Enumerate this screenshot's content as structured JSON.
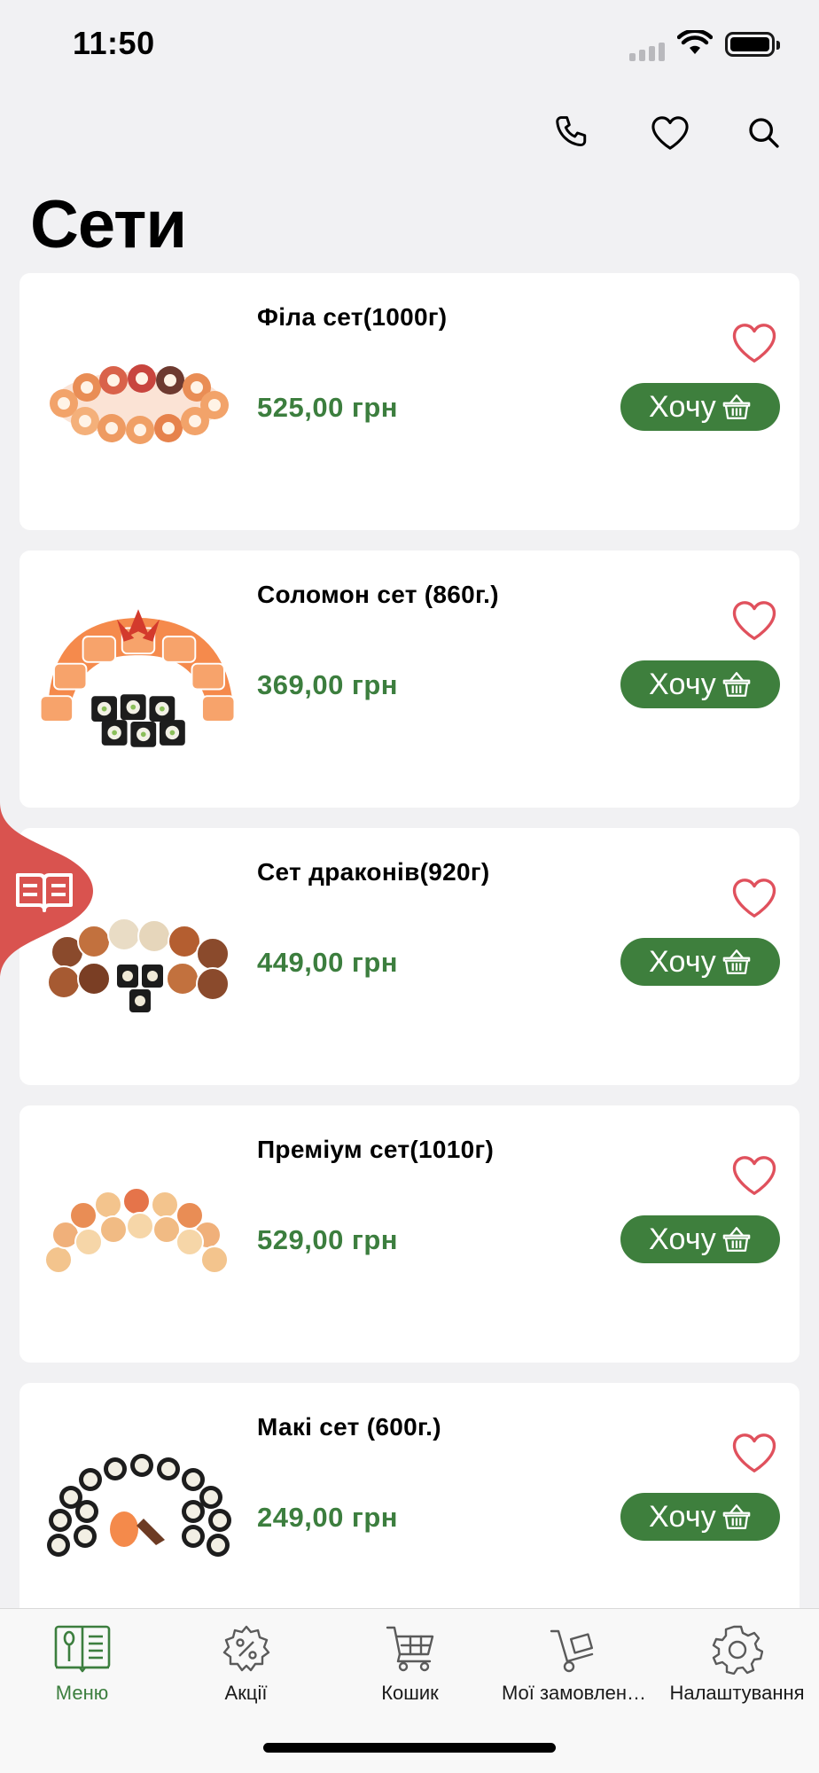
{
  "status_bar": {
    "time": "11:50"
  },
  "colors": {
    "accent": "#3e7f3d",
    "heart": "#e0515d",
    "side_tab": "#d9534f"
  },
  "header": {
    "title": "Сети",
    "icons": [
      "phone-icon",
      "heart-icon",
      "search-icon"
    ]
  },
  "products": [
    {
      "name": "Філа сет(1000г)",
      "price": "525,00 грн",
      "button": "Хочу"
    },
    {
      "name": "Соломон сет (860г.)",
      "price": "369,00 грн",
      "button": "Хочу"
    },
    {
      "name": "Сет драконів(920г)",
      "price": "449,00 грн",
      "button": "Хочу"
    },
    {
      "name": "Преміум сет(1010г)",
      "price": "529,00 грн",
      "button": "Хочу"
    },
    {
      "name": "Макі сет (600г.)",
      "price": "249,00 грн",
      "button": "Хочу"
    }
  ],
  "tabs": [
    {
      "label": "Меню",
      "icon": "menu-book-icon",
      "active": true
    },
    {
      "label": "Акції",
      "icon": "discount-gear-icon",
      "active": false
    },
    {
      "label": "Кошик",
      "icon": "cart-icon",
      "active": false
    },
    {
      "label": "Мої замовлен…",
      "icon": "hand-truck-icon",
      "active": false
    },
    {
      "label": "Налаштування",
      "icon": "settings-icon",
      "active": false
    }
  ]
}
